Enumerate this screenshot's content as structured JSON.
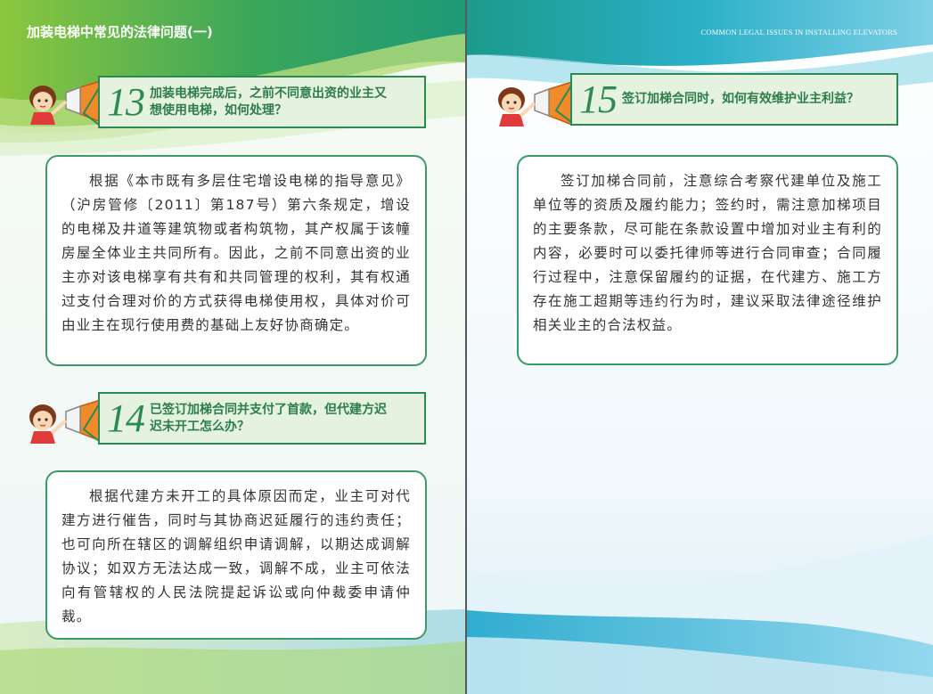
{
  "header": {
    "left_title": "加装电梯中常见的法律问题(一)",
    "right_title": "COMMON LEGAL ISSUES IN INSTALLING ELEVATORS"
  },
  "questions": [
    {
      "number": "13",
      "question_line1": "加装电梯完成后，之前不同意出资的业主又",
      "question_line2": "想使用电梯，如何处理？",
      "answer": "根据《本市既有多层住宅增设电梯的指导意见》（沪房管修〔2011〕第187号）第六条规定，增设的电梯及井道等建筑物或者构筑物，其产权属于该幢房屋全体业主共同所有。因此，之前不同意出资的业主亦对该电梯享有共有和共同管理的权利，其有权通过支付合理对价的方式获得电梯使用权，具体对价可由业主在现行使用费的基础上友好协商确定。"
    },
    {
      "number": "14",
      "question_line1": "已签订加梯合同并支付了首款，但代建方迟",
      "question_line2": "迟未开工怎么办？",
      "answer": "根据代建方未开工的具体原因而定，业主可对代建方进行催告，同时与其协商迟延履行的违约责任；也可向所在辖区的调解组织申请调解，以期达成调解协议；如双方无法达成一致，调解不成，业主可依法向有管辖权的人民法院提起诉讼或向仲裁委申请仲裁。"
    },
    {
      "number": "15",
      "question_line1": "签订加梯合同时，如何有效维护业主利益？",
      "question_line2": "",
      "answer": "签订加梯合同前，注意综合考察代建单位及施工单位等的资质及履约能力；签约时，需注意加梯项目的主要条款，尽可能在条款设置中增加对业主有利的内容，必要时可以委托律师等进行合同审查；合同履行过程中，注意保留履约的证据，在代建方、施工方存在施工超期等违约行为时，建议采取法律途径维护相关业主的合法权益。"
    }
  ],
  "colors": {
    "accent_green": "#2b8a52",
    "question_bg": "#e6f2e0",
    "header_text": "#ffffff"
  }
}
